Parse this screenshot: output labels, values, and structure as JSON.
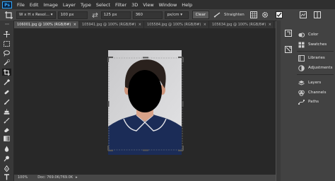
{
  "app": {
    "logo": "Ps"
  },
  "menu": [
    "File",
    "Edit",
    "Image",
    "Layer",
    "Type",
    "Select",
    "Filter",
    "3D",
    "View",
    "Window",
    "Help"
  ],
  "options": {
    "ratio_select": "W x H x Resol...",
    "width_value": "100 px",
    "height_value": "125 px",
    "resolution_value": "360",
    "unit_select": "px/cm",
    "clear_label": "Clear",
    "straighten_label": "Straighten"
  },
  "tabs": [
    {
      "label": "106001.jpg @ 100% (RGB/8#)",
      "close": "×"
    },
    {
      "label": "105941.jpg @ 100% (RGB/8#)",
      "close": "×"
    },
    {
      "label": "105584.jpg @ 100% (RGB/8#)",
      "close": "×"
    },
    {
      "label": "105634.jpg @ 100% (RGB/8#)",
      "close": "×"
    }
  ],
  "status": {
    "zoom": "100%",
    "doc": "Doc: 769.0K/769.0K"
  },
  "panels": {
    "color": "Color",
    "swatches": "Swatches",
    "libraries": "Libraries",
    "adjustments": "Adjustments",
    "layers": "Layers",
    "channels": "Channels",
    "paths": "Paths"
  },
  "colors": {
    "accent": "#31a8ff",
    "canvas": "#282828",
    "panel": "#424242",
    "menubar": "#2f2f2f"
  }
}
